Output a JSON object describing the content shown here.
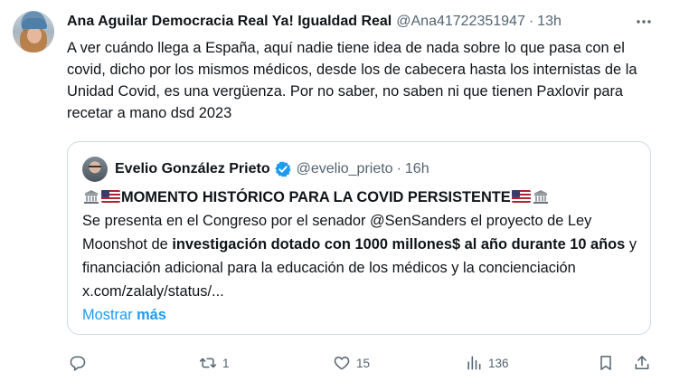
{
  "tweet": {
    "author_name": "Ana Aguilar Democracia Real Ya! Igualdad Real",
    "author_handle": "@Ana41722351947",
    "separator": "·",
    "time": "13h",
    "text": "A ver cuándo llega a España, aquí nadie tiene idea de nada sobre lo que pasa con el covid, dicho por los mismos médicos, desde los de cabecera hasta los internistas de la Unidad Covid, es una vergüenza. Por no saber, no saben ni que tienen Paxlovir para recetar a mano dsd 2023"
  },
  "quote": {
    "author_name": "Evelio González Prieto",
    "author_handle": "@evelio_prieto",
    "separator": "·",
    "time": "16h",
    "headline": "MOMENTO HISTÓRICO PARA LA COVID PERSISTENTE",
    "text_1": "Se presenta en el Congreso por el senador @SenSanders  el proyecto de Ley Moonshot de ",
    "text_bold": "investigación dotado con 1000 millones$ al año durante 10 años",
    "text_2": " y financiación adicional para la educación de los médicos y la concienciación x.com/zalaly/status/...",
    "show_more_prefix": "Mostrar ",
    "show_more_bold": "más"
  },
  "actions": {
    "reply_count": "",
    "retweet_count": "1",
    "like_count": "15",
    "views_count": "136"
  },
  "icons": {
    "more": "more-horizontal-icon",
    "verified": "verified-badge-icon",
    "reply": "reply-icon",
    "retweet": "retweet-icon",
    "like": "heart-icon",
    "views": "views-chart-icon",
    "bookmark": "bookmark-icon",
    "share": "share-icon"
  },
  "colors": {
    "text": "#0f1419",
    "secondary": "#536471",
    "link": "#1d9bf0",
    "border": "#cfd9de"
  }
}
